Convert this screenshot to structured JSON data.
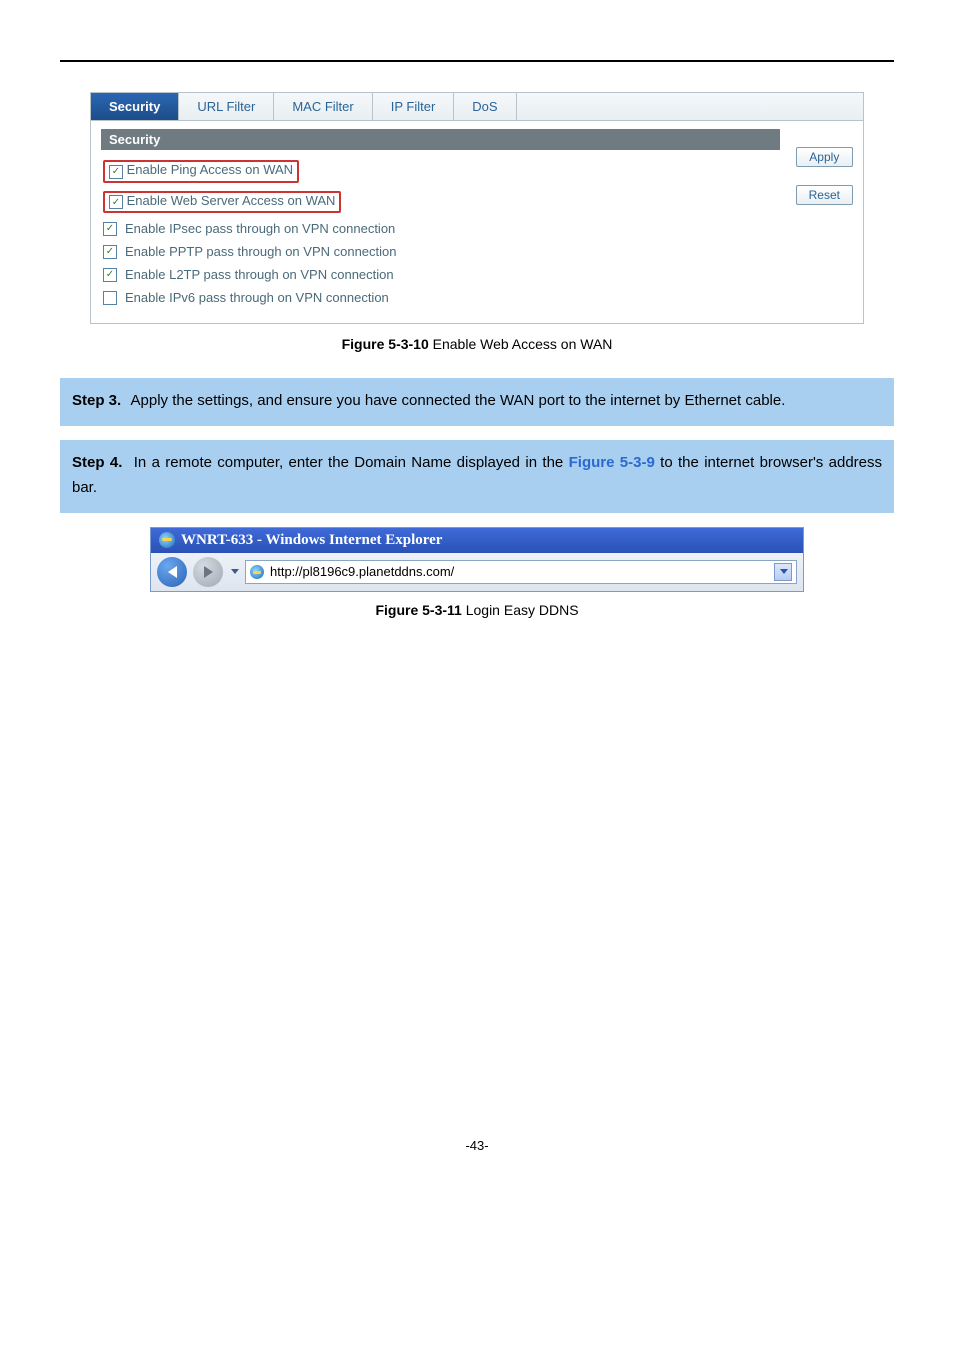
{
  "tabs": [
    "Security",
    "URL Filter",
    "MAC Filter",
    "IP Filter",
    "DoS"
  ],
  "active_tab_index": 0,
  "section_title": "Security",
  "options": [
    {
      "label": "Enable Ping Access on WAN",
      "checked": true,
      "highlight": true
    },
    {
      "label": "Enable Web Server Access on WAN",
      "checked": true,
      "highlight": true
    },
    {
      "label": "Enable IPsec pass through on VPN connection",
      "checked": true,
      "highlight": false
    },
    {
      "label": "Enable PPTP pass through on VPN connection",
      "checked": true,
      "highlight": false
    },
    {
      "label": "Enable L2TP pass through on VPN connection",
      "checked": true,
      "highlight": false
    },
    {
      "label": "Enable IPv6 pass through on VPN connection",
      "checked": false,
      "highlight": false
    }
  ],
  "buttons": {
    "apply": "Apply",
    "reset": "Reset"
  },
  "caption1_bold": "Figure 5-3-10",
  "caption1_rest": " Enable Web Access on WAN",
  "step3_label": "Step 3.",
  "step3_text": "Apply the settings, and ensure you have connected the WAN port to the internet by Ethernet cable.",
  "step4_label": "Step 4.",
  "step4_pre": "In a remote computer, enter the Domain Name displayed in the ",
  "step4_figref": "Figure 5-3-9",
  "step4_post": " to the internet browser's address bar.",
  "ie_title": "WNRT-633 - Windows Internet Explorer",
  "ie_url": "http://pl8196c9.planetddns.com/",
  "caption2_bold": "Figure 5-3-11",
  "caption2_rest": " Login Easy DDNS",
  "footer": "-43-"
}
